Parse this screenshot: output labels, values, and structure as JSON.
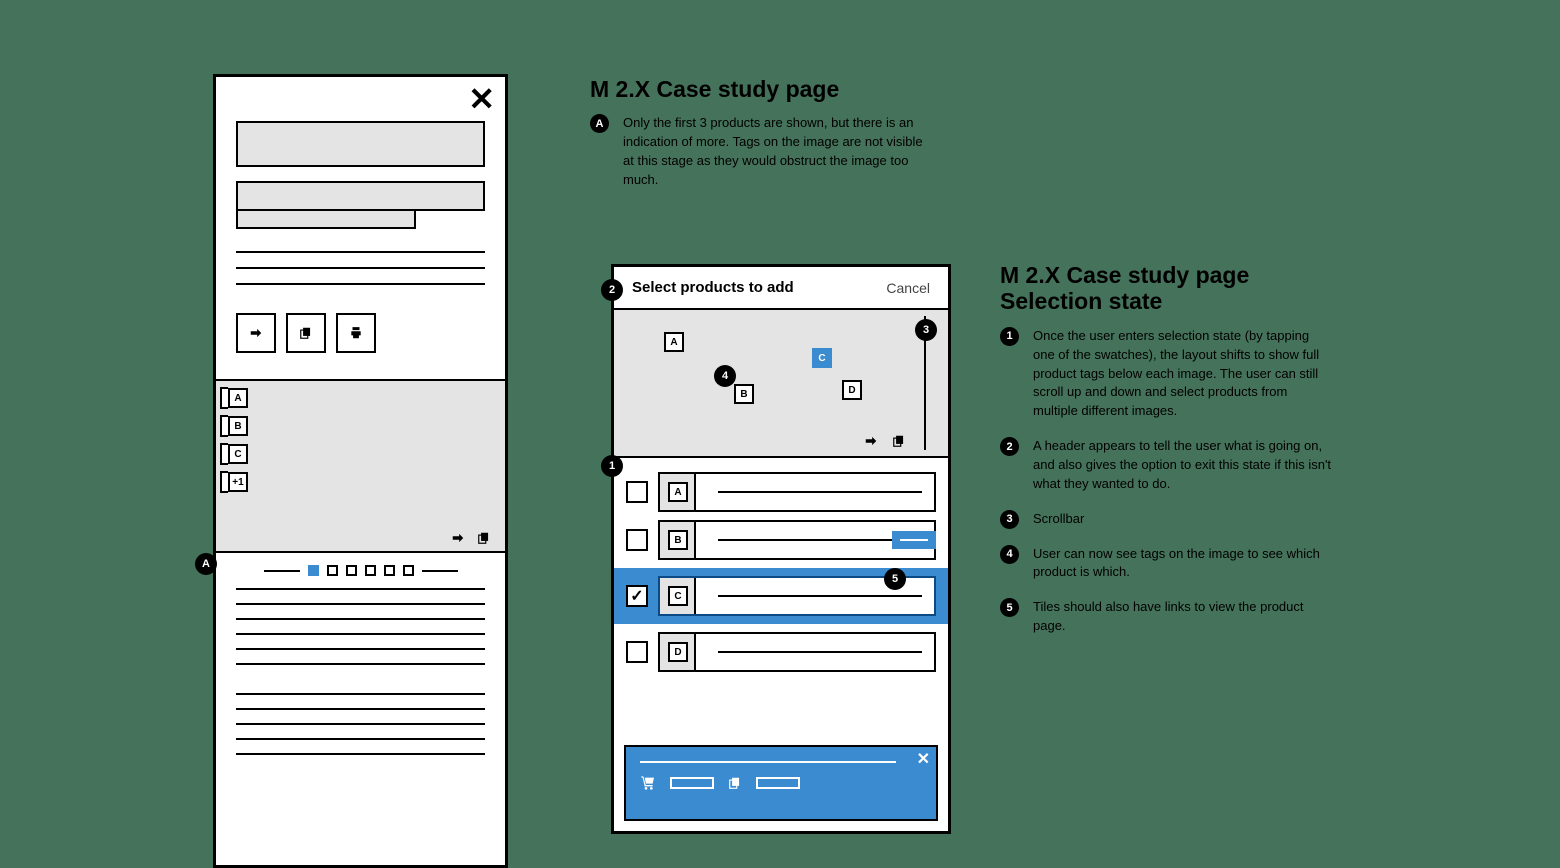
{
  "col1": {
    "heading": "M 2.X Case study page",
    "notes": {
      "A": "Only the first 3 products are shown, but there is an indication of more. Tags on the image are not visible at this stage as they would obstruct the image too much."
    }
  },
  "col2": {
    "heading": "M 2.X Case study page\nSelection state",
    "notes": {
      "1": "Once the user enters selection state (by tapping one of the swatches), the layout shifts to show full product tags below each image. The user can still scroll up and down and select products from multiple different images.",
      "2": "A header appears to tell the user what is going on, and also gives the option to exit this state if this isn't what they wanted to do.",
      "3": "Scrollbar",
      "4": "User can now see tags on the image to see which product is which.",
      "5": "Tiles should also have links to view the product page."
    }
  },
  "mid": {
    "header_title": "Select products to add",
    "header_cancel": "Cancel",
    "image_tags": [
      "A",
      "B",
      "C",
      "D"
    ],
    "rows": [
      {
        "letter": "A",
        "selected": false,
        "hasPill": false
      },
      {
        "letter": "B",
        "selected": false,
        "hasPill": true
      },
      {
        "letter": "C",
        "selected": true,
        "hasPill": false
      },
      {
        "letter": "D",
        "selected": false,
        "hasPill": false
      }
    ]
  },
  "left": {
    "side_tags": [
      "A",
      "B",
      "C"
    ],
    "side_more": "+1",
    "page_dots": 6,
    "active_dot": 1
  },
  "glyphs": {
    "close_x": "✕",
    "check": "✓"
  }
}
